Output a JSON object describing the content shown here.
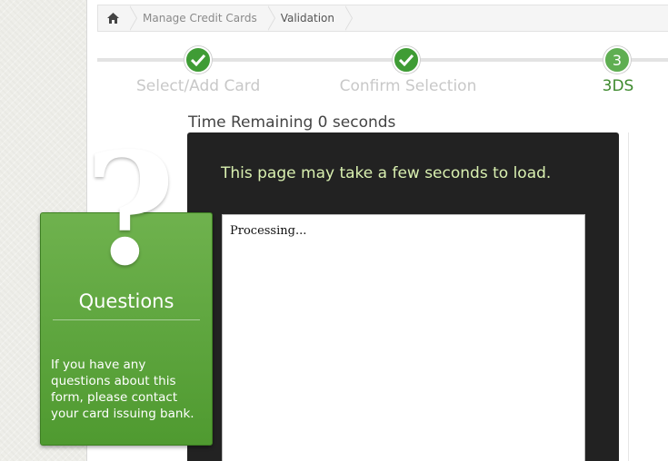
{
  "breadcrumb": {
    "home_icon": "home-icon",
    "items": [
      "Manage Credit Cards",
      "Validation"
    ]
  },
  "steps": [
    {
      "label": "Select/Add Card",
      "status": "complete",
      "icon": "check-icon"
    },
    {
      "label": "Confirm Selection",
      "status": "complete",
      "icon": "check-icon"
    },
    {
      "label": "3DS",
      "status": "current",
      "number": "3"
    }
  ],
  "timer": {
    "text": "Time Remaining 0 seconds"
  },
  "content": {
    "message": "This page may take a few seconds to load.",
    "frame_text": "Processing..."
  },
  "questions": {
    "icon": "question-mark-icon",
    "title": "Questions",
    "body": "If you have any questions about this form, please contact your card issuing bank."
  },
  "colors": {
    "accent_green": "#3f9c35",
    "current_step": "#3e8a2e",
    "dark_panel": "#222222"
  }
}
